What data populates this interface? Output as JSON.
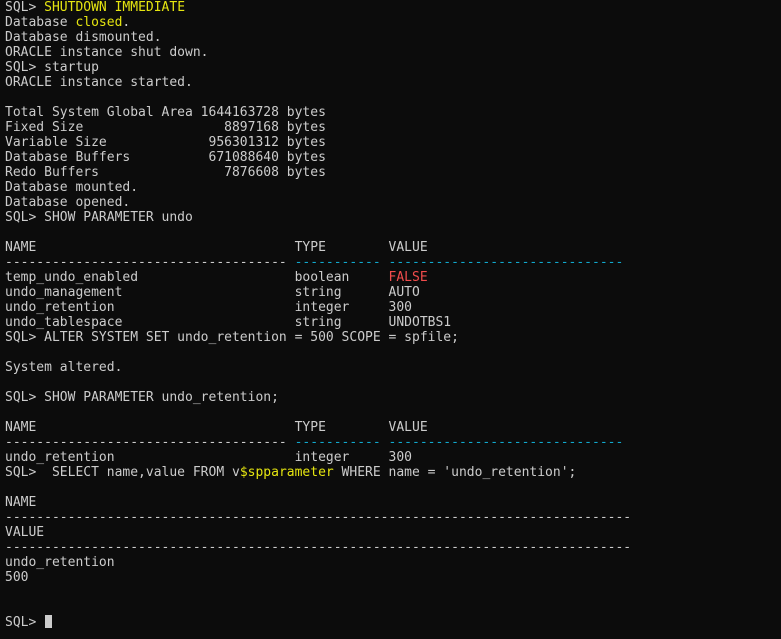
{
  "colors": {
    "background": "#0c0c0c",
    "text": "#cccccc",
    "keyword": "#e5e510",
    "false_value": "#f14c4c",
    "separator": "#11a8cd",
    "cursor": "#cccccc"
  },
  "terminal": {
    "lines": [
      [
        [
          "SQL> ",
          "plain"
        ],
        [
          "SHUTDOWN",
          "yellow"
        ],
        [
          " ",
          "plain"
        ],
        [
          "IMMEDIATE",
          "yellow"
        ]
      ],
      [
        [
          "Database ",
          "plain"
        ],
        [
          "closed",
          "yellow"
        ],
        [
          ".",
          "plain"
        ]
      ],
      [
        [
          "Database dismounted.",
          "plain"
        ]
      ],
      [
        [
          "ORACLE instance shut down.",
          "plain"
        ]
      ],
      [
        [
          "SQL> startup",
          "plain"
        ]
      ],
      [
        [
          "ORACLE instance started.",
          "plain"
        ]
      ],
      [
        [
          "",
          "plain"
        ]
      ],
      [
        [
          "Total System Global Area 1644163728 bytes",
          "plain"
        ]
      ],
      [
        [
          "Fixed Size                  8897168 bytes",
          "plain"
        ]
      ],
      [
        [
          "Variable Size             956301312 bytes",
          "plain"
        ]
      ],
      [
        [
          "Database Buffers          671088640 bytes",
          "plain"
        ]
      ],
      [
        [
          "Redo Buffers                7876608 bytes",
          "plain"
        ]
      ],
      [
        [
          "Database mounted.",
          "plain"
        ]
      ],
      [
        [
          "Database opened.",
          "plain"
        ]
      ],
      [
        [
          "SQL> SHOW PARAMETER undo",
          "plain"
        ]
      ],
      [
        [
          "",
          "plain"
        ]
      ],
      [
        [
          "NAME                                 TYPE        VALUE",
          "plain"
        ]
      ],
      [
        [
          "------------------------------------ ",
          "plain"
        ],
        [
          "----------- ------------------------------",
          "cyan"
        ]
      ],
      [
        [
          "temp_undo_enabled                    boolean     ",
          "plain"
        ],
        [
          "FALSE",
          "red"
        ]
      ],
      [
        [
          "undo_management                      string      AUTO",
          "plain"
        ]
      ],
      [
        [
          "undo_retention                       integer     300",
          "plain"
        ]
      ],
      [
        [
          "undo_tablespace                      string      UNDOTBS1",
          "plain"
        ]
      ],
      [
        [
          "SQL> ALTER SYSTEM SET undo_retention = 500 SCOPE = spfile;",
          "plain"
        ]
      ],
      [
        [
          "",
          "plain"
        ]
      ],
      [
        [
          "System altered.",
          "plain"
        ]
      ],
      [
        [
          "",
          "plain"
        ]
      ],
      [
        [
          "SQL> SHOW PARAMETER undo_retention;",
          "plain"
        ]
      ],
      [
        [
          "",
          "plain"
        ]
      ],
      [
        [
          "NAME                                 TYPE        VALUE",
          "plain"
        ]
      ],
      [
        [
          "------------------------------------ ",
          "plain"
        ],
        [
          "----------- ------------------------------",
          "cyan"
        ]
      ],
      [
        [
          "undo_retention                       integer     300",
          "plain"
        ]
      ],
      [
        [
          "SQL>  SELECT name,value FROM v",
          "plain"
        ],
        [
          "$spparameter",
          "yellow"
        ],
        [
          " WHERE name = 'undo_retention';",
          "plain"
        ]
      ],
      [
        [
          "",
          "plain"
        ]
      ],
      [
        [
          "NAME",
          "plain"
        ]
      ],
      [
        [
          "--------------------------------------------------------------------------------",
          "plain"
        ]
      ],
      [
        [
          "VALUE",
          "plain"
        ]
      ],
      [
        [
          "--------------------------------------------------------------------------------",
          "plain"
        ]
      ],
      [
        [
          "undo_retention",
          "plain"
        ]
      ],
      [
        [
          "500",
          "plain"
        ]
      ],
      [
        [
          "",
          "plain"
        ]
      ],
      [
        [
          "",
          "plain"
        ]
      ],
      [
        [
          "SQL> ",
          "plain"
        ]
      ]
    ]
  }
}
